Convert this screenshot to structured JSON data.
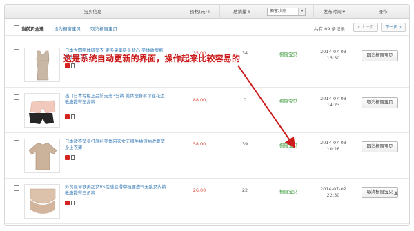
{
  "header": {
    "col_product": "宝贝信息",
    "col_price": "价格(元)",
    "col_sales": "总销量",
    "status_select": "橱窗状态",
    "col_time": "发布时间",
    "col_action": "操作"
  },
  "toolbar": {
    "select_all": "当前页全选",
    "set_showcase": "设为橱窗宝贝",
    "cancel_showcase": "取消橱窗宝贝",
    "count_text": "共有 69 条记录",
    "prev": "« 上一页",
    "next": "下一页 »"
  },
  "annotation": "这是系统自动更新的界面，操作起来比较容易的",
  "rows": [
    {
      "title": "日本大圆明体硫塑衣 更多采集吸身背心 美体收腹瓶 身上衣打底",
      "price": "35.00",
      "sales": "34",
      "status": "橱窗宝贝",
      "date": "2014-07-03",
      "time": "15:30",
      "button": "取消橱窗宝贝"
    },
    {
      "title": "出口日本专柜正品防走光3分裤 美体塑身裤冰丝花边收腹提臀塑身裤",
      "price": "88.00",
      "sales": "0",
      "status": "橱窗宝贝",
      "date": "2014-07-03",
      "time": "14:23",
      "button": "取消橱窗宝贝"
    },
    {
      "title": "日本款不塑身打底衫美体内衣女无缝牛袖短袖收腹塑身上衣薄",
      "price": "58.00",
      "sales": "39",
      "status": "橱窗宝贝",
      "date": "2014-07-03",
      "time": "10:26",
      "button": "取消橱窗宝贝"
    },
    {
      "title": "外贸原单联美超女VS性感丝滑中档腰透气无痕女内裤收腹提臀三角裤",
      "price": "26.00",
      "sales": "22",
      "status": "橱窗宝贝",
      "date": "2014-07-02",
      "time": "22:30",
      "button": "取消橱窗宝贝"
    }
  ],
  "colors": {
    "link": "#3a7cb8",
    "price": "#d44a3a",
    "status": "#3c9a3c",
    "annotation": "#cc1b1b"
  }
}
